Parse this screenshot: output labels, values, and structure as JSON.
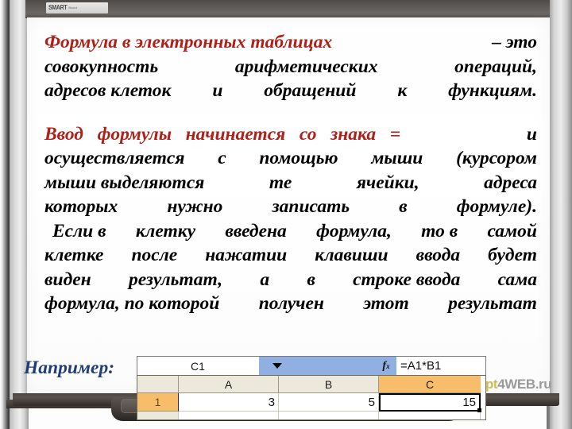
{
  "board": {
    "logo_text": "SMART",
    "logo_sub": "Board"
  },
  "slide": {
    "paragraph1": {
      "highlight": "Формула в электронных таблицах",
      "lines": [
        " – это",
        "совокупность   арифметических   операций,",
        "адресов клеток  и  обращений  к  функциям."
      ],
      "line2_parts": [
        "совокупность",
        "арифметических",
        "операций,"
      ],
      "line3_parts": [
        "адресов клеток",
        "и",
        "обращений",
        "к",
        "функциям."
      ]
    },
    "paragraph2": {
      "highlight": "Ввод   формулы   начинается   со   знака   =",
      "tail": "  и",
      "lines": [
        "осуществляется   с   помощью   мыши   (курсором",
        "мыши  выделяются   те   ячейки,   адреса",
        "которых   нужно   записать   в   формуле).",
        " Если  в  клетку  введена  формула,  то  в  самой",
        "клетке   после   нажатии   клавиши   ввода   будет",
        "виден  результат,  а  в  строке ввода  сама",
        "формула, по которой   получен   этот   результат"
      ],
      "l1_parts": [
        "осуществляется",
        "с",
        "помощью",
        "мыши",
        "(курсором"
      ],
      "l2_parts": [
        "мыши выделяются",
        "те",
        "ячейки,",
        "адреса"
      ],
      "l3_parts": [
        "которых",
        "нужно",
        "записать",
        "в",
        "формуле)."
      ],
      "l4_parts": [
        "Если в",
        "клетку",
        "введена",
        "формула,",
        "то в",
        "самой"
      ],
      "l5_parts": [
        "клетке",
        "после",
        "нажатии",
        "клавиши",
        "ввода",
        "будет"
      ],
      "l6_parts": [
        "виден",
        "результат,",
        "а",
        "в",
        "строке ввода",
        "сама"
      ],
      "l7_parts": [
        "формула, по которой",
        "получен",
        "этот",
        "результат"
      ]
    },
    "example_label": "Например:"
  },
  "excel": {
    "name_box_value": "C1",
    "dropdown_icon": "chevron-down-icon",
    "fx_label": "fx",
    "formula_value": "=A1*B1",
    "corner_header": "",
    "column_headers": [
      "A",
      "B",
      "C"
    ],
    "row_header": "1",
    "row_values": [
      "3",
      "5",
      "15"
    ],
    "selected_cell": "C1",
    "selected_column": "C"
  },
  "watermark": {
    "part1": "Ppt",
    "part2": "4WEB.ru"
  },
  "colors": {
    "accent_red": "#b01f18",
    "accent_blue": "#1f3d7a",
    "excel_bar": "#8fb0e0",
    "excel_selected": "#f8bd6a",
    "excel_header": "#ece9dc"
  }
}
